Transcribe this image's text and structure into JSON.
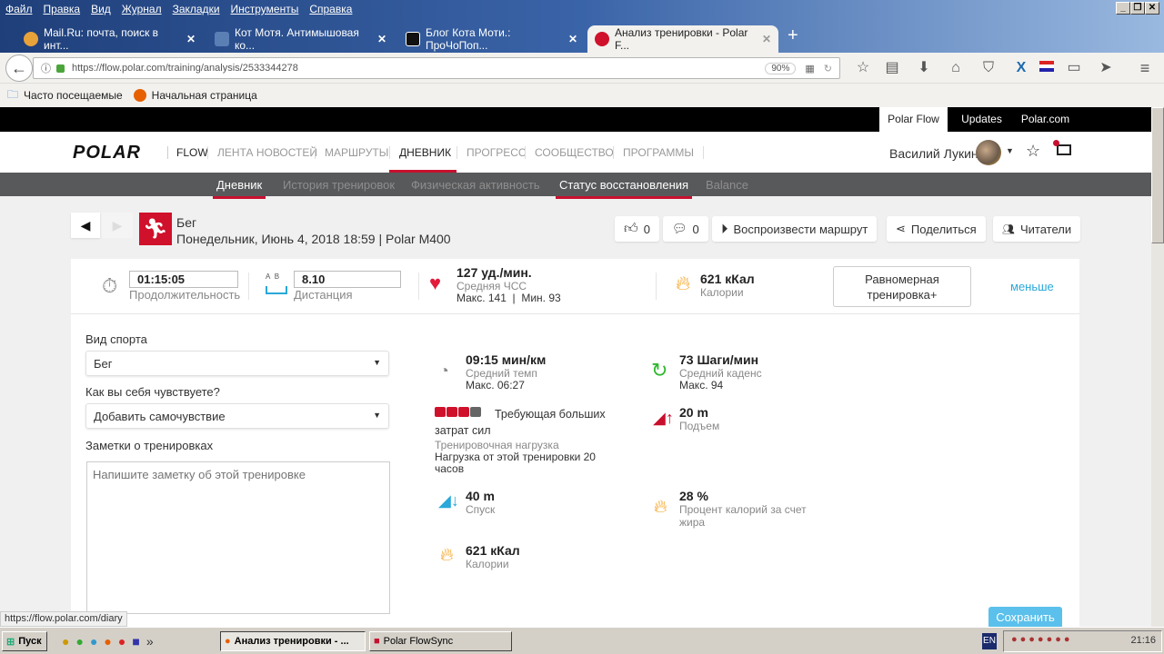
{
  "browser": {
    "menu": [
      "Файл",
      "Правка",
      "Вид",
      "Журнал",
      "Закладки",
      "Инструменты",
      "Справка"
    ],
    "tabs": [
      {
        "title": "Mail.Ru: почта, поиск в инт..."
      },
      {
        "title": "Кот Мотя. Антимышовая ко..."
      },
      {
        "title": "Блог Кота Моти.: ПроЧоПоп..."
      },
      {
        "title": "Анализ тренировки - Polar F..."
      }
    ],
    "url": "https://flow.polar.com/training/analysis/2533344278",
    "zoom": "90%",
    "bookmarks": [
      "Часто посещаемые",
      "Начальная страница"
    ],
    "status_url": "https://flow.polar.com/diary"
  },
  "site": {
    "top_links": [
      "Polar Flow",
      "Updates",
      "Polar.com"
    ],
    "logo": "POLAR",
    "flow": "FLOW",
    "nav": [
      "ЛЕНТА НОВОСТЕЙ",
      "МАРШРУТЫ",
      "ДНЕВНИК",
      "ПРОГРЕСС",
      "СООБЩЕСТВО",
      "ПРОГРАММЫ"
    ],
    "user": "Василий Лукин",
    "subnav": [
      "Дневник",
      "История тренировок",
      "Физическая активность",
      "Статус восстановления",
      "Balance"
    ]
  },
  "activity": {
    "sport": "Бег",
    "subtitle": "Понедельник, Июнь 4, 2018 18:59 | Polar M400",
    "likes": "0",
    "comments": "0",
    "replay": "Воспроизвести маршрут",
    "share": "Поделиться",
    "followers": "Читатели"
  },
  "summary": {
    "duration": "01:15:05",
    "duration_label": "Продолжительность",
    "ab_a": "A",
    "ab_b": "B",
    "distance": "8.10",
    "distance_label": "Дистанция",
    "hr": "127 уд./мин.",
    "hr_label": "Средняя ЧСС",
    "hr_minmax": "Макс. 141  |  Мин. 93",
    "cal": "621 кКал",
    "cal_label": "Калории",
    "benefit": "Равномерная тренировка+",
    "less": "меньше"
  },
  "form": {
    "sport_label": "Вид спорта",
    "sport_value": "Бег",
    "feel_label": "Как вы себя чувствуете?",
    "feel_value": "Добавить самочувствие",
    "notes_label": "Заметки о тренировках",
    "notes_placeholder": "Напишите заметку об этой тренировке",
    "save": "Сохранить"
  },
  "details": {
    "pace": "09:15 мин/км",
    "pace_label": "Средний темп",
    "pace_max": "Макс. 06:27",
    "cadence": "73 Шаги/мин",
    "cadence_label": "Средний каденс",
    "cadence_max": "Макс. 94",
    "load_level": 3,
    "load_max": 5,
    "load_text": "Требующая больших затрат сил",
    "load_label": "Тренировочная нагрузка",
    "load_recovery": "Нагрузка от этой тренировки 20 часов",
    "ascent": "20 m",
    "ascent_label": "Подъем",
    "descent": "40 m",
    "descent_label": "Спуск",
    "fat": "28 %",
    "fat_label": "Процент калорий за счет жира",
    "cal": "621 кКал",
    "cal_label": "Калории"
  },
  "taskbar": {
    "start": "Пуск",
    "windows": [
      "Анализ тренировки - ...",
      "Polar FlowSync"
    ],
    "lang": "EN",
    "clock": "21:16"
  },
  "colors": {
    "polar_red": "#d0112b",
    "accent_blue": "#5bc0eb"
  }
}
